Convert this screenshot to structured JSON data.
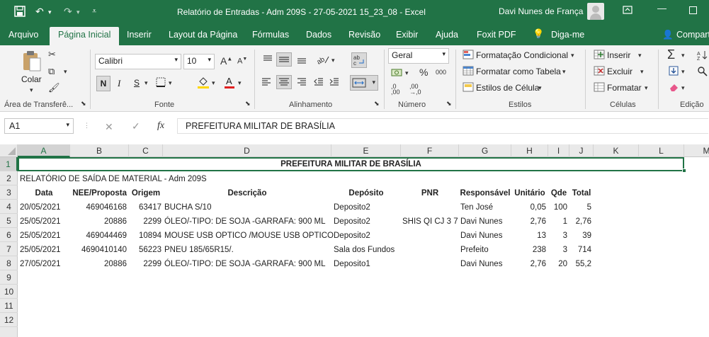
{
  "window": {
    "title": "Relatório de Entradas - Adm 209S - 27-05-2021 15_23_08  -  Excel",
    "user": "Davi Nunes de França"
  },
  "tabs": [
    "Arquivo",
    "Página Inicial",
    "Inserir",
    "Layout da Página",
    "Fórmulas",
    "Dados",
    "Revisão",
    "Exibir",
    "Ajuda",
    "Foxit PDF",
    "Diga-me",
    "Compart"
  ],
  "ribbon": {
    "clipboard": {
      "paste": "Colar",
      "label": "Área de Transferê..."
    },
    "font": {
      "name": "Calibri",
      "size": "10",
      "label": "Fonte",
      "bold": "N",
      "italic": "I",
      "underline": "S",
      "font_color": "#e02020",
      "fill_color": "#ffd700"
    },
    "alignment": {
      "label": "Alinhamento"
    },
    "number": {
      "format": "Geral",
      "label": "Número"
    },
    "styles": {
      "cond": "Formatação Condicional",
      "table": "Formatar como Tabela",
      "cell": "Estilos de Célula",
      "label": "Estilos"
    },
    "cells": {
      "insert": "Inserir",
      "delete": "Excluir",
      "format": "Formatar",
      "label": "Células"
    },
    "editing": {
      "label": "Edição"
    }
  },
  "formula": {
    "name_box": "A1",
    "content": "PREFEITURA MILITAR DE BRASÍLIA"
  },
  "columns": [
    "A",
    "B",
    "C",
    "D",
    "E",
    "F",
    "G",
    "H",
    "I",
    "J",
    "K",
    "L",
    "M"
  ],
  "rows": [
    "1",
    "2",
    "3",
    "4",
    "5",
    "6",
    "7",
    "8",
    "9",
    "10",
    "11",
    "12"
  ],
  "sheet": {
    "title": "PREFEITURA MILITAR DE BRASÍLIA",
    "subtitle": "RELATÓRIO DE SAÍDA DE MATERIAL - Adm 209S",
    "headers": [
      "Data",
      "NEE/Proposta",
      "Origem",
      "Descrição",
      "Depósito",
      "PNR",
      "Responsável",
      "Unitário",
      "Qde",
      "Total"
    ],
    "data": [
      [
        "20/05/2021",
        "469046168",
        "63417",
        "BUCHA S/10",
        "Deposito2",
        "",
        "Ten José",
        "0,05",
        "100",
        "5"
      ],
      [
        "25/05/2021",
        "20886",
        "2299",
        "ÓLEO/-TIPO: DE SOJA -GARRAFA: 900 ML",
        "Deposito2",
        "SHIS QI CJ 3 7",
        "Davi Nunes",
        "2,76",
        "1",
        "2,76"
      ],
      [
        "25/05/2021",
        "469044469",
        "10894",
        "MOUSE USB OPTICO /MOUSE USB OPTICO",
        "Deposito2",
        "",
        "Davi Nunes",
        "13",
        "3",
        "39"
      ],
      [
        "25/05/2021",
        "4690410140",
        "56223",
        "PNEU 185/65R15/.",
        "Sala dos Fundos",
        "",
        "Prefeito",
        "238",
        "3",
        "714"
      ],
      [
        "27/05/2021",
        "20886",
        "2299",
        "ÓLEO/-TIPO: DE SOJA -GARRAFA: 900 ML",
        "Deposito1",
        "",
        "Davi Nunes",
        "2,76",
        "20",
        "55,2"
      ]
    ]
  }
}
